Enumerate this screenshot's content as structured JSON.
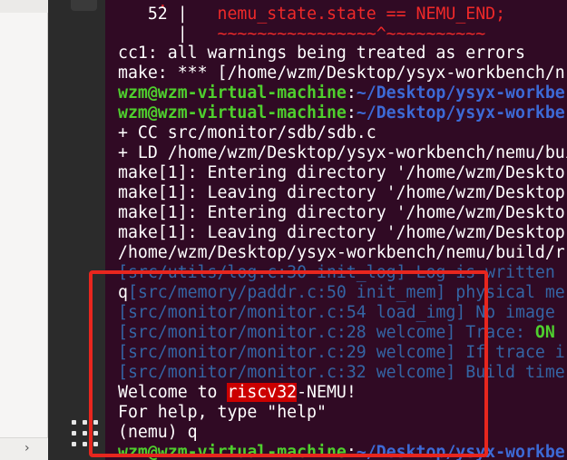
{
  "expander": {
    "icon": "chevron-right-icon",
    "glyph": "›"
  },
  "terminal": {
    "l52_num": "52 |",
    "l52_code": "nemu_state.state == NEMU_END;",
    "l_bar": "|",
    "l_tilde": "~~~~~~~~~~~~~~~~^~~~~~~~~~~",
    "cc1": "cc1: all warnings being treated as errors",
    "make_err": "make: *** [/home/wzm/Desktop/ysyx-workbench/n",
    "prompt_user": "wzm@wzm-virtual-machine",
    "prompt_colon": ":",
    "prompt_path": "~/Desktop/ysyx-workbe",
    "cc_line": "+ CC src/monitor/sdb/sdb.c",
    "ld_line": "+ LD /home/wzm/Desktop/ysyx-workbench/nemu/bui",
    "make_enter": "make[1]: Entering directory '/home/wzm/Deskto",
    "make_leave": "make[1]: Leaving directory '/home/wzm/Desktop",
    "build_path": "/home/wzm/Desktop/ysyx-workbench/nemu/build/r",
    "log_written": "[src/utils/log.c:30 init_log] Log is written",
    "q_char": "q",
    "paddr_line": "[src/memory/paddr.c:50 init_mem] physical me",
    "load_img": "[src/monitor/monitor.c:54 load_img] No image",
    "trace_prefix": "[src/monitor/monitor.c:28 welcome] Trace: ",
    "trace_on": "ON",
    "if_trace": "[src/monitor/monitor.c:29 welcome] If trace i",
    "build_time": "[src/monitor/monitor.c:32 welcome] Build time",
    "welcome_pre": "Welcome to ",
    "welcome_arch": "riscv32",
    "welcome_post": "-NEMU!",
    "help_line": "For help, type \"help\"",
    "nemu_prompt": "(nemu) q",
    "last_path": "~/Desktop/ysyx-workbe"
  },
  "colors": {
    "terminal_bg": "#300a24",
    "prompt_green": "#4fcf2e",
    "path_blue": "#3d6ad6",
    "error_red": "#ef2929",
    "annotation_box": "#e8261e"
  }
}
